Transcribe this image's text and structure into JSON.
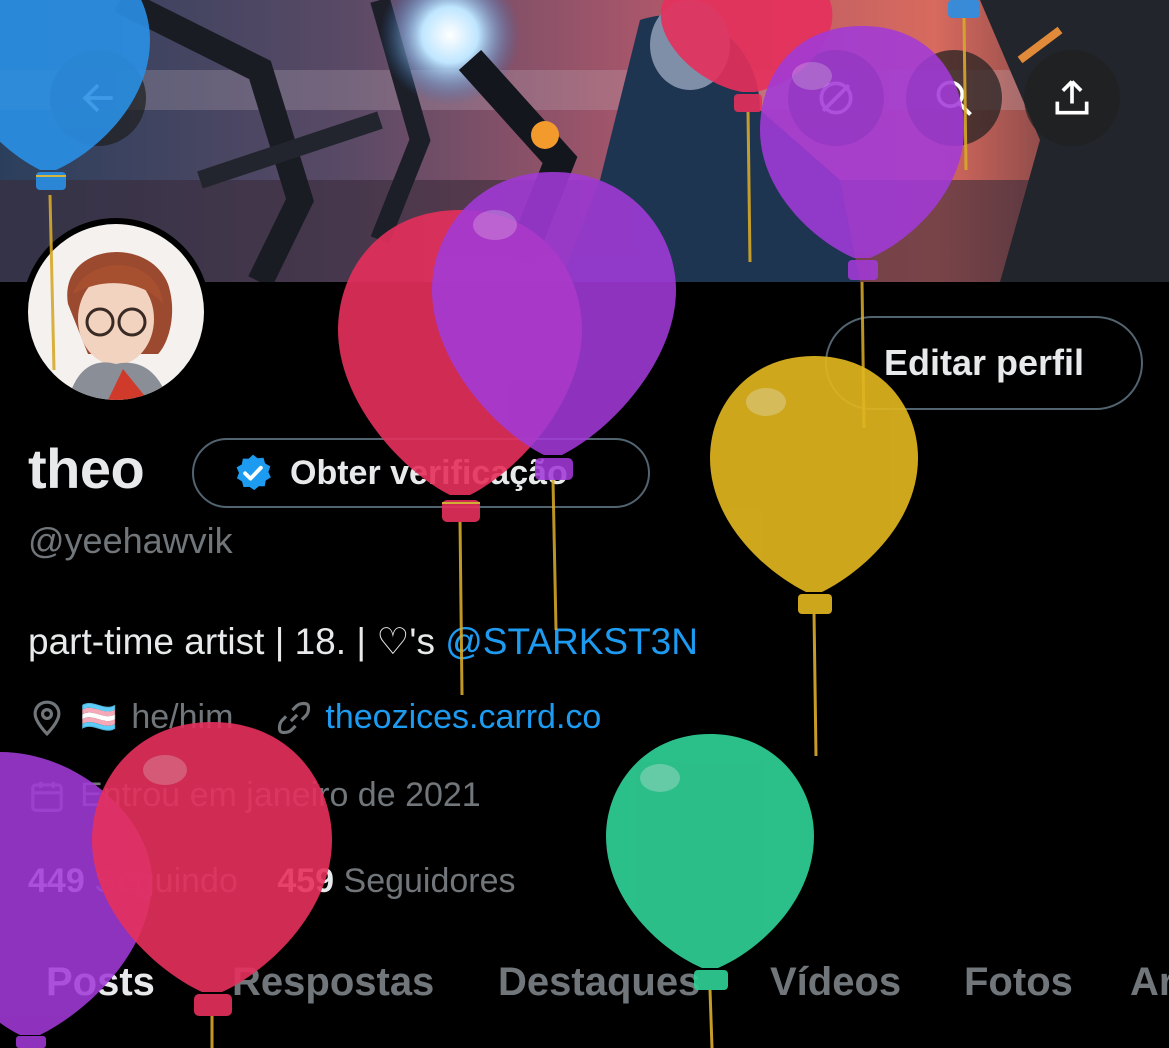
{
  "header": {
    "back_icon": "arrow-left-icon",
    "grok_icon": "grok-icon",
    "search_icon": "search-icon",
    "share_icon": "share-icon"
  },
  "profile": {
    "name": "theo",
    "verify_label": "Obter verificação",
    "handle": "@yeehawvik",
    "edit_label": "Editar perfil",
    "bio_text": "part-time artist | 18. | ♡'s ",
    "bio_mention": "@STARKST3N",
    "flag": "🏳️‍⚧️",
    "pronouns": "he/him",
    "website": "theozices.carrd.co",
    "joined": "Entrou em janeiro de 2021",
    "following_count": "449",
    "following_label": "Seguindo",
    "followers_count": "459",
    "followers_label": "Seguidores"
  },
  "tabs": [
    "Posts",
    "Respostas",
    "Destaques",
    "Vídeos",
    "Fotos",
    "Ar"
  ],
  "colors": {
    "accent": "#1d9bf0",
    "text": "#e7e9ea",
    "muted": "#71767b",
    "border": "#536471",
    "balloon_red": "#e6305c",
    "balloon_purple": "#a23ad8",
    "balloon_yellow": "#e0b51f",
    "balloon_green": "#2fcf95",
    "balloon_blue": "#2a90e6"
  }
}
